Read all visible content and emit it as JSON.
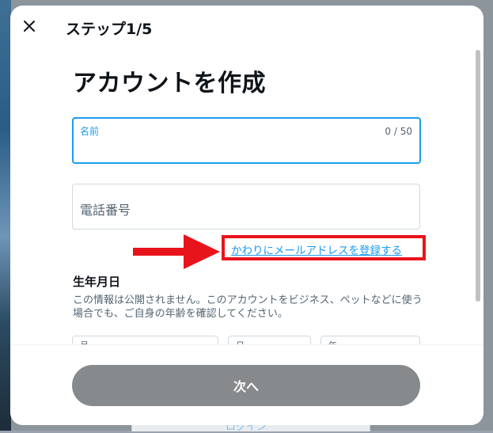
{
  "header": {
    "step_title": "ステップ1/5",
    "close_icon": "close-icon"
  },
  "main": {
    "title": "アカウントを作成",
    "name_field": {
      "label": "名前",
      "counter": "0 / 50",
      "value": ""
    },
    "phone_field": {
      "placeholder": "電話番号"
    },
    "email_link": "かわりにメールアドレスを登録する",
    "annotation": {
      "arrow_icon": "red-arrow-icon",
      "highlight_color": "#e8141c"
    },
    "dob": {
      "title": "生年月日",
      "description": "この情報は公開されません。このアカウントをビジネス、ペットなどに使う場合でも、ご自身の年齢を確認してください。",
      "month_label": "月",
      "day_label": "日",
      "year_label": "年"
    }
  },
  "footer": {
    "next_label": "次へ"
  },
  "background": {
    "peek_text": "ログイン"
  },
  "colors": {
    "accent": "#1d9bf0",
    "button_disabled": "#878a8c"
  }
}
